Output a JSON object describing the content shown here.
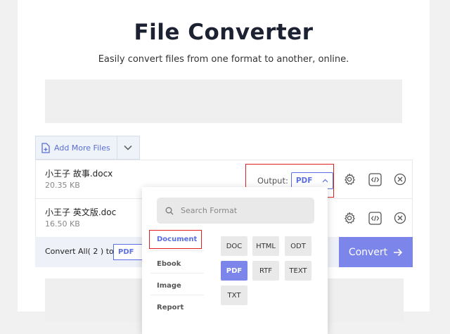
{
  "header": {
    "title": "File Converter",
    "subtitle": "Easily convert files from one format to another, online."
  },
  "toolbar": {
    "add_more_label": "Add More Files"
  },
  "files": [
    {
      "name": "小王子 故事.docx",
      "size": "20.35 KB"
    },
    {
      "name": "小王子 英文版.doc",
      "size": "16.50 KB"
    }
  ],
  "output": {
    "label": "Output:",
    "selected": "PDF"
  },
  "convert_bar": {
    "label": "Convert All( 2 ) to:",
    "selected": "PDF",
    "button_label": "Convert"
  },
  "format_dropdown": {
    "search_placeholder": "Search Format",
    "categories": [
      "Document",
      "Ebook",
      "Image",
      "Report"
    ],
    "active_category": "Document",
    "formats": [
      "DOC",
      "HTML",
      "ODT",
      "PDF",
      "RTF",
      "TEXT",
      "TXT"
    ],
    "active_format": "PDF"
  },
  "colors": {
    "accent": "#7b85ea",
    "highlight_border": "#e02020",
    "link": "#5b6fe0"
  },
  "icons": {
    "add_file": "file-plus-icon",
    "settings": "gear-icon",
    "embed": "code-icon",
    "remove": "close-circle-icon"
  }
}
